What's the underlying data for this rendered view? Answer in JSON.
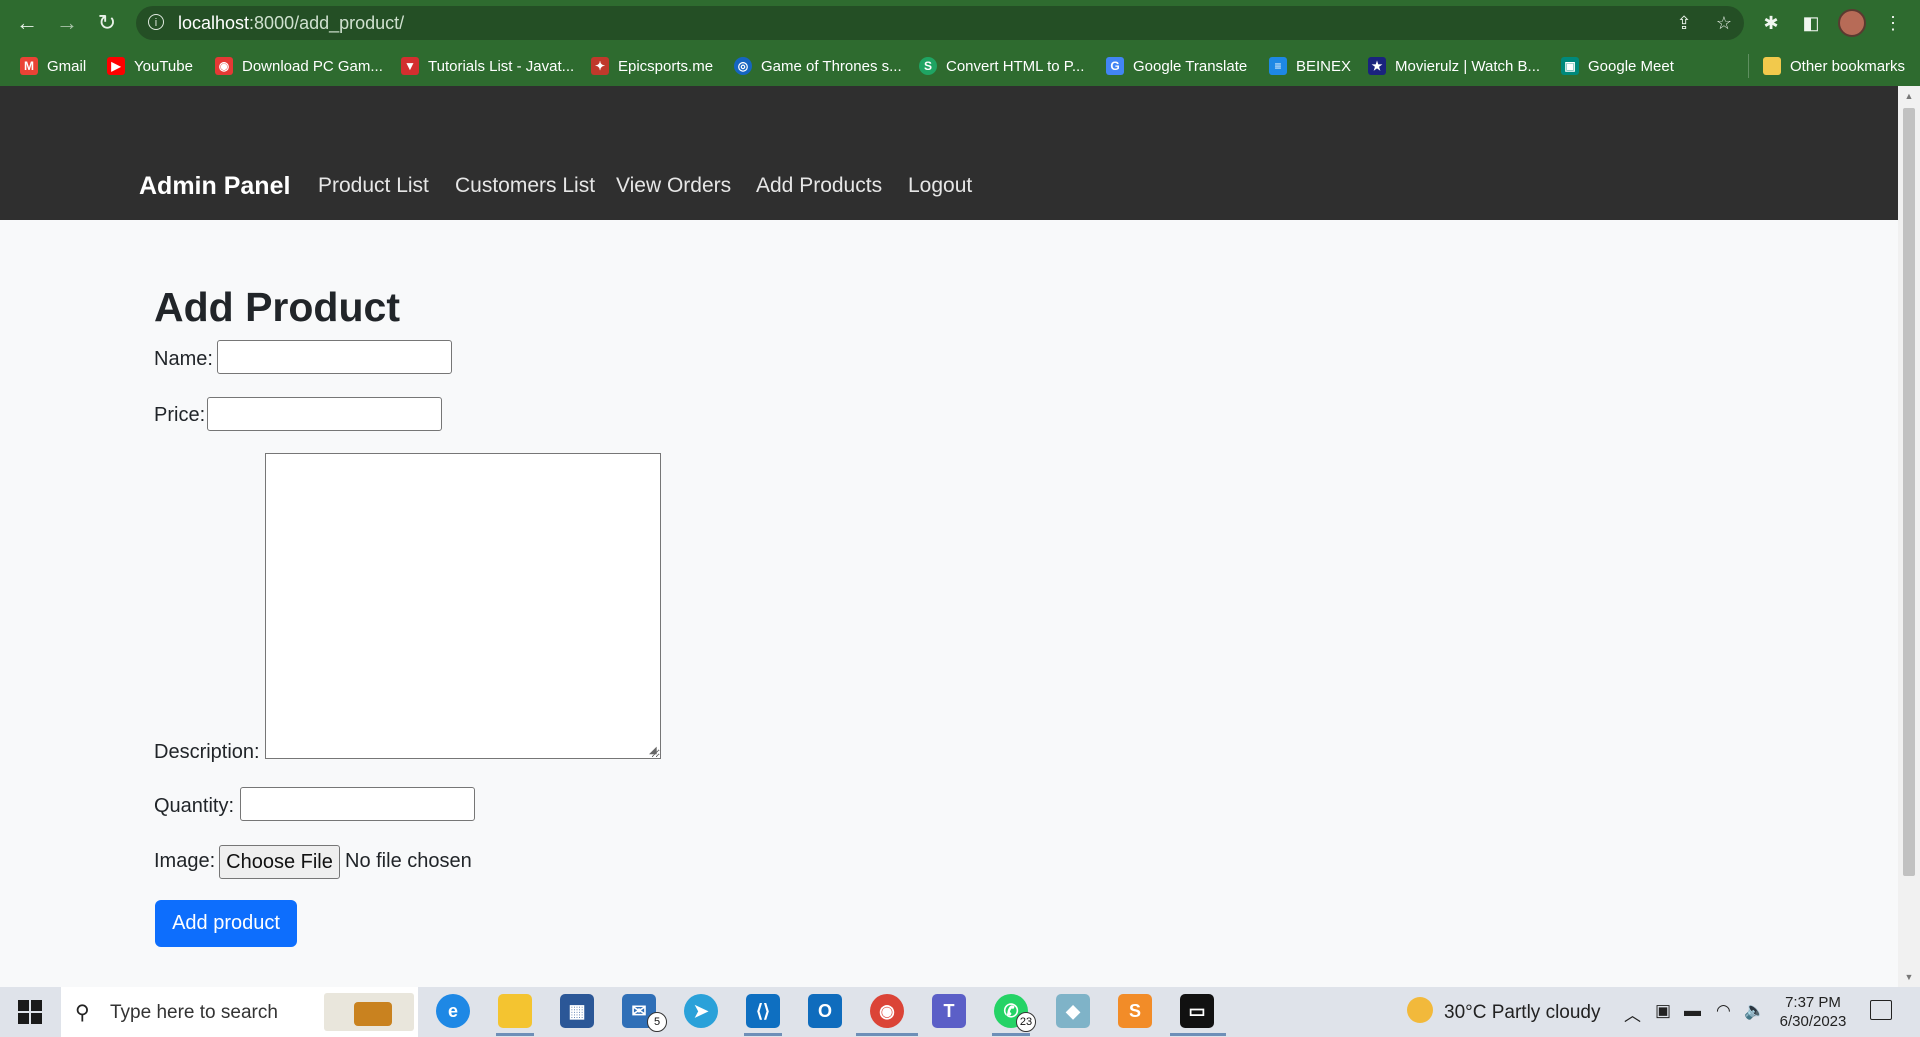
{
  "browser": {
    "url_host": "localhost",
    "url_path": ":8000/add_product/",
    "bookmarks": [
      {
        "label": "Gmail",
        "icon": "gmail-icon",
        "color": "#ea4335"
      },
      {
        "label": "YouTube",
        "icon": "youtube-icon",
        "color": "#ff0000"
      },
      {
        "label": "Download PC Gam...",
        "icon": "game-icon",
        "color": "#e53935"
      },
      {
        "label": "Tutorials List - Javat...",
        "icon": "javatpoint-icon",
        "color": "#d32f2f"
      },
      {
        "label": "Epicsports.me",
        "icon": "epicsports-icon",
        "color": "#c0392b"
      },
      {
        "label": "Game of Thrones s...",
        "icon": "globe-icon",
        "color": "#1565c0"
      },
      {
        "label": "Convert HTML to P...",
        "icon": "convert-icon",
        "color": "#1fa463"
      },
      {
        "label": "Google Translate",
        "icon": "translate-icon",
        "color": "#4285f4"
      },
      {
        "label": "BEINEX",
        "icon": "beinex-icon",
        "color": "#1e88e5"
      },
      {
        "label": "Movierulz | Watch B...",
        "icon": "movierulz-icon",
        "color": "#1a237e"
      },
      {
        "label": "Google Meet",
        "icon": "meet-icon",
        "color": "#00897b"
      }
    ],
    "other_bookmarks": "Other bookmarks"
  },
  "navbar": {
    "brand": "Admin Panel",
    "links": [
      "Product List",
      "Customers List",
      "View Orders",
      "Add Products",
      "Logout"
    ]
  },
  "form": {
    "title": "Add Product",
    "name_label": "Name:",
    "price_label": "Price:",
    "description_label": "Description:",
    "quantity_label": "Quantity:",
    "image_label": "Image:",
    "file_button": "Choose File",
    "file_status": "No file chosen",
    "submit": "Add product"
  },
  "taskbar": {
    "search_placeholder": "Type here to search",
    "weather": "30°C  Partly cloudy",
    "time": "7:37 PM",
    "date": "6/30/2023",
    "mail_badge": "5",
    "whatsapp_badge": "23"
  },
  "colors": {
    "chrome_green": "#2e6b2f",
    "navbar_dark": "#2f2f2f",
    "primary_button": "#0d6efd"
  }
}
